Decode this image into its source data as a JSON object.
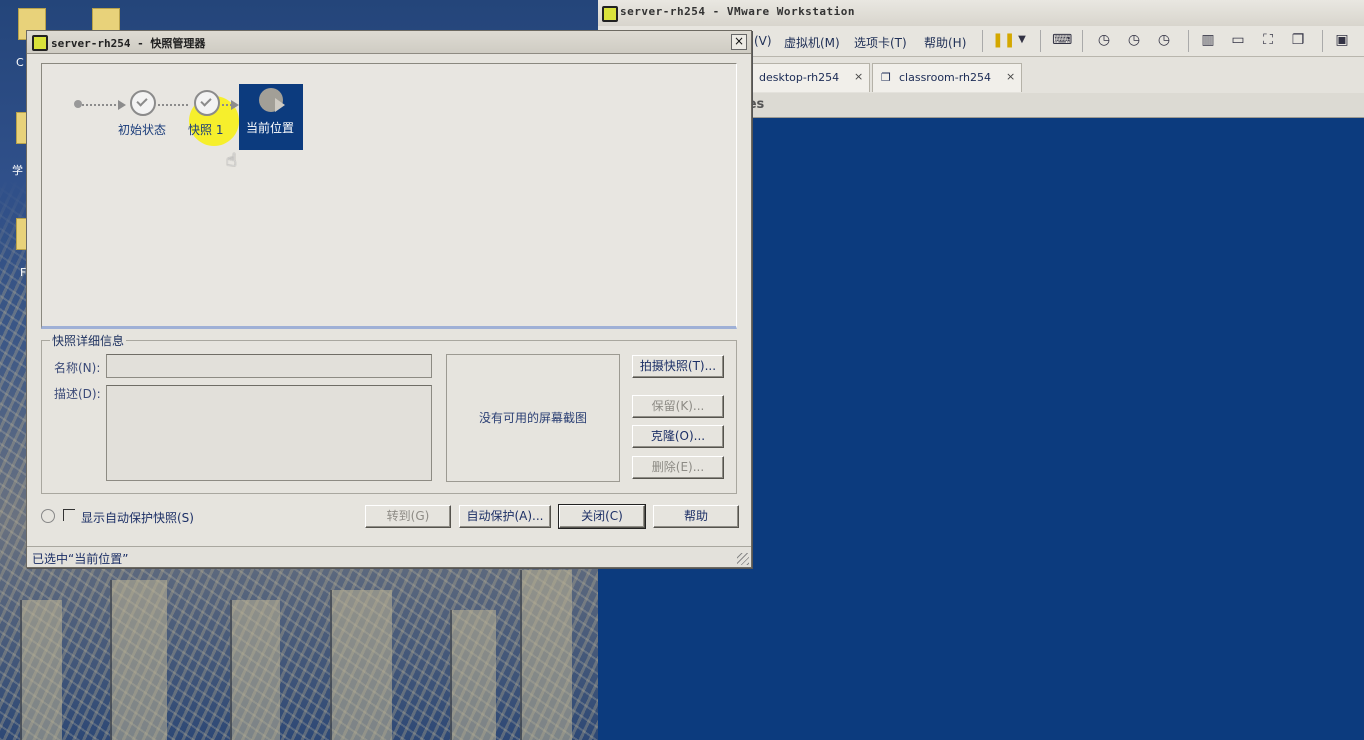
{
  "desktop": {
    "icon_labels": [
      "C",
      "学",
      "F"
    ]
  },
  "vmware": {
    "window_title": "server-rh254 - VMware Workstation",
    "menu": [
      "(V)",
      "虚拟机(M)",
      "选项卡(T)",
      "帮助(H)"
    ],
    "tabs": [
      {
        "label": "desktop-rh254",
        "close": "×"
      },
      {
        "label": "classroom-rh254",
        "close": "×"
      }
    ],
    "subheader_fragment": "ces"
  },
  "dialog": {
    "title": "server-rh254 - 快照管理器",
    "close_glyph": "×",
    "tree": {
      "nodes": [
        "初始状态",
        "快照 1",
        "当前位置"
      ]
    },
    "details": {
      "legend": "快照详细信息",
      "name_label": "名称(N):",
      "desc_label": "描述(D):",
      "preview_text": "没有可用的屏幕截图"
    },
    "side_buttons": {
      "take": "拍摄快照(T)...",
      "keep": "保留(K)...",
      "clone": "克隆(O)...",
      "delete": "删除(E)..."
    },
    "bottom": {
      "show_autoprotect": "显示自动保护快照(S)",
      "goto": "转到(G)",
      "autoprotect": "自动保护(A)...",
      "close": "关闭(C)",
      "help": "帮助"
    },
    "status_text": "已选中“当前位置”"
  }
}
